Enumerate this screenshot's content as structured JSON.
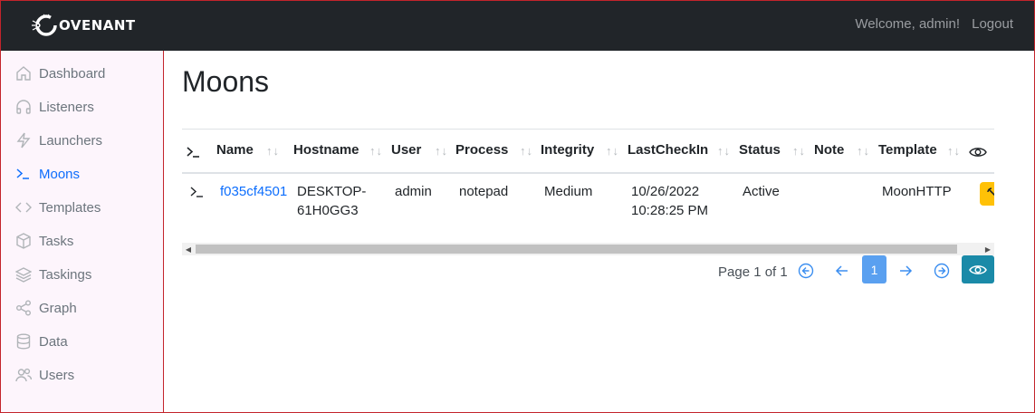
{
  "header": {
    "brand": "OVENANT",
    "welcome": "Welcome, admin!",
    "logout": "Logout"
  },
  "sidebar": {
    "items": [
      {
        "label": "Dashboard",
        "icon": "home-icon",
        "active": false
      },
      {
        "label": "Listeners",
        "icon": "headphones-icon",
        "active": false
      },
      {
        "label": "Launchers",
        "icon": "lightning-icon",
        "active": false
      },
      {
        "label": "Moons",
        "icon": "terminal-icon",
        "active": true
      },
      {
        "label": "Templates",
        "icon": "code-icon",
        "active": false
      },
      {
        "label": "Tasks",
        "icon": "box-icon",
        "active": false
      },
      {
        "label": "Taskings",
        "icon": "layers-icon",
        "active": false
      },
      {
        "label": "Graph",
        "icon": "share-icon",
        "active": false
      },
      {
        "label": "Data",
        "icon": "database-icon",
        "active": false
      },
      {
        "label": "Users",
        "icon": "people-icon",
        "active": false
      }
    ]
  },
  "main": {
    "title": "Moons",
    "table": {
      "columns": [
        "Name",
        "Hostname",
        "User",
        "Process",
        "Integrity",
        "LastCheckIn",
        "Status",
        "Note",
        "Template"
      ],
      "sort_glyph": "↑↓",
      "rows": [
        {
          "name": "f035cf4501",
          "hostname_line1": "DESKTOP-",
          "hostname_line2": "61H0GG3",
          "user": "admin",
          "process": "notepad",
          "integrity": "Medium",
          "lastcheckin_line1": "10/26/2022",
          "lastcheckin_line2": "10:28:25 PM",
          "status": "Active",
          "note": "",
          "template": "MoonHTTP"
        }
      ]
    },
    "pagination": {
      "info": "Page 1 of 1",
      "current": "1"
    }
  },
  "colors": {
    "topbar": "#212529",
    "sidebar_bg": "#fdf5fc",
    "accent": "#0d6efd",
    "warning": "#ffc107",
    "info": "#1a8aa8"
  }
}
